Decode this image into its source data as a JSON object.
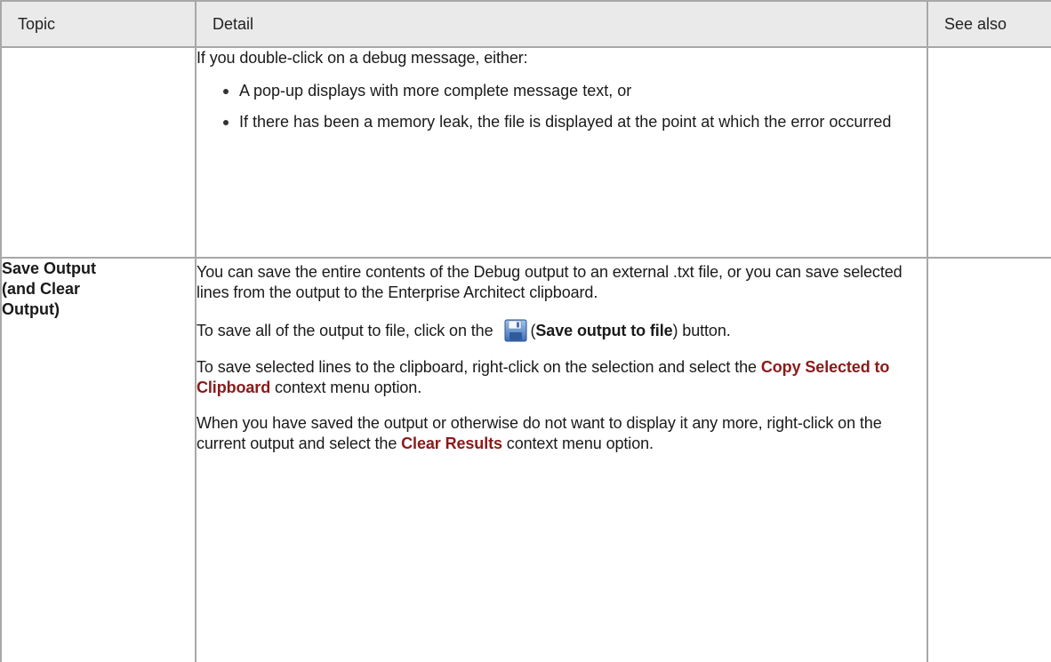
{
  "table": {
    "headers": {
      "topic": "Topic",
      "detail": "Detail",
      "see_also": "See also"
    },
    "row1": {
      "intro": "If you double-click on a debug message, either:",
      "bullets": [
        "A pop-up displays with more complete message text, or",
        "If there has been a memory leak, the file is displayed at the point at which the error occurred"
      ]
    },
    "row2": {
      "topic_line1": "Save Output",
      "topic_line2": "(and Clear",
      "topic_line3": "Output)",
      "para1": "You can save the entire contents of the Debug output to an external .txt file, or you can save selected lines from the output to the Enterprise Architect clipboard.",
      "para2_before": "To save all of the output to file, click on the",
      "para2_open": "(",
      "para2_bold": "Save output to file",
      "para2_after": ") button.",
      "para3_before": "To save selected lines to the clipboard, right-click on the selection and select the ",
      "para3_menu": "Copy Selected to Clipboard",
      "para3_after": " context menu option.",
      "para4_before": "When you have saved the output or otherwise do not want to display it any more, right-click on the current output and select the ",
      "para4_menu": "Clear Results",
      "para4_after": " context menu option."
    }
  },
  "icons": {
    "save": "floppy-disk-save-icon"
  },
  "colors": {
    "menu_option": "#8b1a1a",
    "header_bg": "#eaeaea",
    "border": "#a8a8a8"
  }
}
